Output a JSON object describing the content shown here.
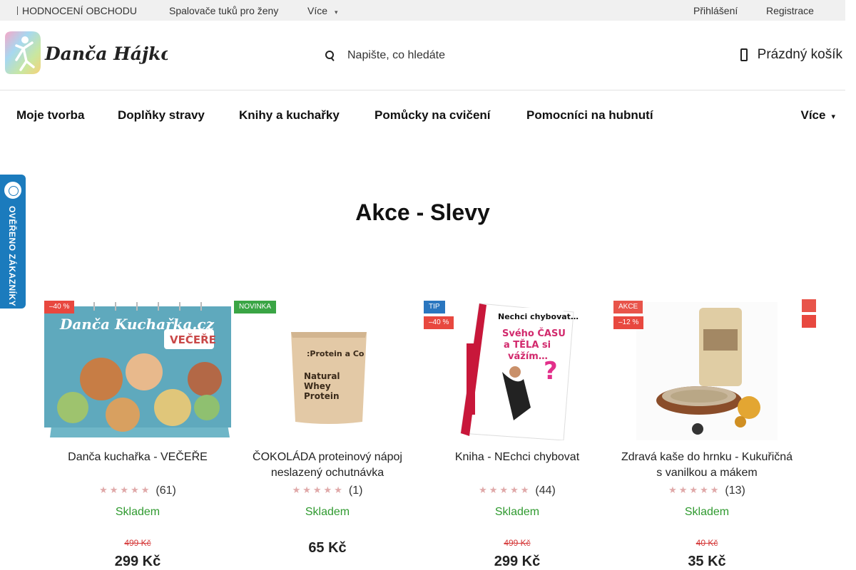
{
  "topbar": {
    "rating": "HODNOCENÍ OBCHODU",
    "link1": "Spalovače tuků pro ženy",
    "more": "Více",
    "login": "Přihlášení",
    "register": "Registrace"
  },
  "header": {
    "logo_text": "Danča Hájková",
    "search_placeholder": "Napište, co hledáte",
    "cart": "Prázdný košík"
  },
  "nav": {
    "items": [
      "Moje tvorba",
      "Doplňky stravy",
      "Knihy a kuchařky",
      "Pomůcky na cvičení",
      "Pomocníci na hubnutí"
    ],
    "more": "Více"
  },
  "trust_badge": {
    "text": "OVĚŘENO ZÁKAZNÍKY"
  },
  "page": {
    "title": "Akce - Slevy"
  },
  "products": [
    {
      "flags": [
        {
          "type": "discount",
          "text": "–40 %"
        }
      ],
      "name": "Danča kuchařka - VEČEŘE",
      "rating_count": "(61)",
      "stock": "Skladem",
      "old_price": "499 Kč",
      "price": "299 Kč"
    },
    {
      "flags": [
        {
          "type": "new",
          "text": "NOVINKA"
        }
      ],
      "name": "ČOKOLÁDA proteinový nápoj neslazený ochutnávka",
      "rating_count": "(1)",
      "stock": "Skladem",
      "old_price": "",
      "price": "65 Kč"
    },
    {
      "flags": [
        {
          "type": "tip",
          "text": "TIP"
        },
        {
          "type": "discount",
          "text": "–40 %"
        }
      ],
      "name": "Kniha - NEchci chybovat",
      "rating_count": "(44)",
      "stock": "Skladem",
      "old_price": "499 Kč",
      "price": "299 Kč"
    },
    {
      "flags": [
        {
          "type": "action",
          "text": "AKCE"
        },
        {
          "type": "discount",
          "text": "–12 %"
        }
      ],
      "name": "Zdravá kaše do hrnku - Kukuřičná s vanilkou a mákem",
      "rating_count": "(13)",
      "stock": "Skladem",
      "old_price": "40 Kč",
      "price": "35 Kč"
    }
  ],
  "stars_glyph": "★★★★★",
  "colors": {
    "accent_green": "#2f9a2f",
    "discount_red": "#e8483f",
    "badge_blue": "#1b7bbd"
  }
}
